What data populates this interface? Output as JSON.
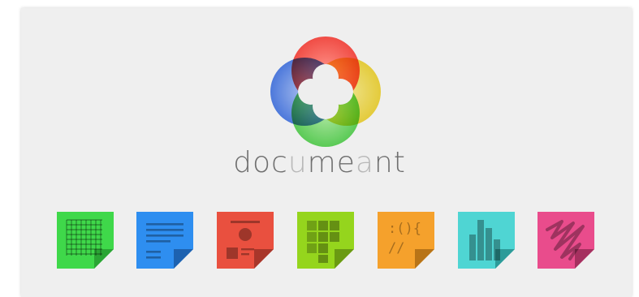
{
  "brand": {
    "name_parts": [
      {
        "text": "doc",
        "accent": false
      },
      {
        "text": "u",
        "accent": true
      },
      {
        "text": "me",
        "accent": false
      },
      {
        "text": "a",
        "accent": true
      },
      {
        "text": "nt",
        "accent": false
      }
    ]
  },
  "colors": {
    "background": "#efefef",
    "wordmark": "#6f6f6f",
    "wordmark_accent": "#b8b8b8"
  },
  "document_types": [
    {
      "name": "spreadsheet-icon",
      "color": "#3fd84a",
      "fold": "#2aa534",
      "glyph": "grid"
    },
    {
      "name": "text-document-icon",
      "color": "#2e8ef0",
      "fold": "#1d62b0",
      "glyph": "lines"
    },
    {
      "name": "presentation-icon",
      "color": "#e9503f",
      "fold": "#a8362a",
      "glyph": "slide"
    },
    {
      "name": "tiles-icon",
      "color": "#95d51d",
      "fold": "#6a9a12",
      "glyph": "blocks"
    },
    {
      "name": "code-icon",
      "color": "#f5a12c",
      "fold": "#b87417",
      "glyph": "code",
      "code_line1": ":(){",
      "code_line2": "//"
    },
    {
      "name": "chart-icon",
      "color": "#4fd5d3",
      "fold": "#2d9b99",
      "glyph": "bars"
    },
    {
      "name": "drawing-icon",
      "color": "#e94c8c",
      "fold": "#a5305f",
      "glyph": "scribble"
    }
  ]
}
